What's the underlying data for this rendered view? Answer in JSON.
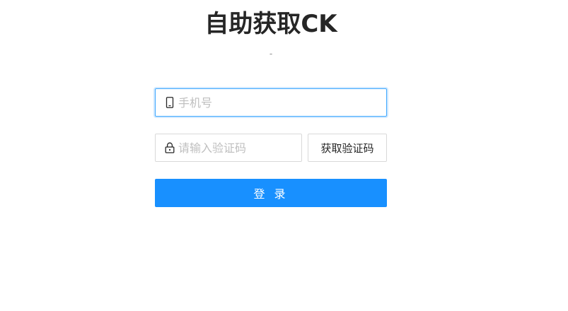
{
  "header": {
    "title": "自助获取CK",
    "subtitle": "-"
  },
  "form": {
    "phone": {
      "placeholder": "手机号",
      "value": "",
      "icon": "mobile-icon"
    },
    "code": {
      "placeholder": "请输入验证码",
      "value": "",
      "icon": "lock-icon"
    },
    "send_code_label": "获取验证码",
    "login_label": "登 录"
  },
  "colors": {
    "primary": "#1890ff",
    "focus_border": "#40a9ff",
    "border": "#d9d9d9",
    "placeholder": "#bfbfbf",
    "title": "#262626"
  }
}
